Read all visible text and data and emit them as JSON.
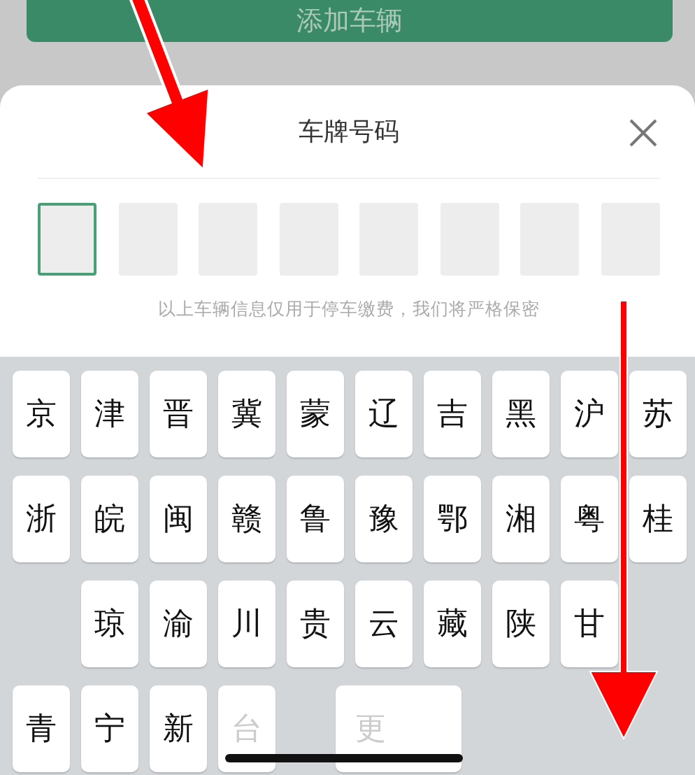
{
  "background_button": {
    "label": "添加车辆"
  },
  "sheet": {
    "title": "车牌号码",
    "plate_slots": [
      {
        "selected": true
      },
      {
        "selected": false
      },
      {
        "selected": false
      },
      {
        "selected": false
      },
      {
        "selected": false
      },
      {
        "selected": false
      },
      {
        "selected": false
      },
      {
        "selected": false
      }
    ],
    "hint": "以上车辆信息仅用于停车缴费，我们将严格保密"
  },
  "keyboard": {
    "rows": [
      [
        {
          "label": "京",
          "disabled": false
        },
        {
          "label": "津",
          "disabled": false
        },
        {
          "label": "晋",
          "disabled": false
        },
        {
          "label": "冀",
          "disabled": false
        },
        {
          "label": "蒙",
          "disabled": false
        },
        {
          "label": "辽",
          "disabled": false
        },
        {
          "label": "吉",
          "disabled": false
        },
        {
          "label": "黑",
          "disabled": false
        },
        {
          "label": "沪",
          "disabled": false
        },
        {
          "label": "苏",
          "disabled": false
        }
      ],
      [
        {
          "label": "浙",
          "disabled": false
        },
        {
          "label": "皖",
          "disabled": false
        },
        {
          "label": "闽",
          "disabled": false
        },
        {
          "label": "赣",
          "disabled": false
        },
        {
          "label": "鲁",
          "disabled": false
        },
        {
          "label": "豫",
          "disabled": false
        },
        {
          "label": "鄂",
          "disabled": false
        },
        {
          "label": "湘",
          "disabled": false
        },
        {
          "label": "粤",
          "disabled": false
        },
        {
          "label": "桂",
          "disabled": false
        }
      ],
      [
        {},
        {
          "label": "琼",
          "disabled": false
        },
        {
          "label": "渝",
          "disabled": false
        },
        {
          "label": "川",
          "disabled": false
        },
        {
          "label": "贵",
          "disabled": false
        },
        {
          "label": "云",
          "disabled": false
        },
        {
          "label": "藏",
          "disabled": false
        },
        {
          "label": "陕",
          "disabled": false
        },
        {
          "label": "甘",
          "disabled": false
        }
      ],
      [
        {
          "label": "青",
          "disabled": false
        },
        {
          "label": "宁",
          "disabled": false
        },
        {
          "label": "新",
          "disabled": false
        },
        {
          "label": "台",
          "disabled": true
        },
        {},
        {
          "label": "更",
          "disabled": true,
          "kind": "wide"
        }
      ]
    ]
  }
}
